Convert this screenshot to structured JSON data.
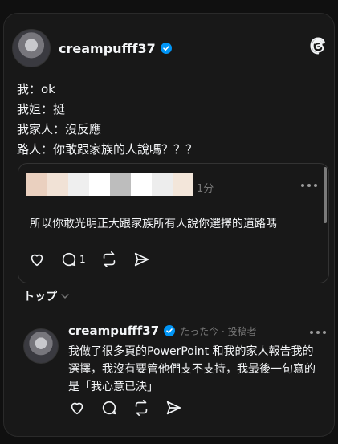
{
  "post": {
    "username": "creampufff37",
    "verified": true,
    "lines": [
      "我：ok",
      "我姐：挺",
      "我家人：沒反應",
      "路人：你敢跟家族的人說嗎？？？"
    ]
  },
  "quote": {
    "time": "1分",
    "text": "所以你敢光明正大跟家族所有人說你選擇的道路嗎",
    "reply_count": "1",
    "blurred_colors": [
      "#ead0bf",
      "#f1e2d6",
      "#efefef",
      "#ffffff",
      "#bdbdbd",
      "#ffffff",
      "#ededed",
      "#f3e6da"
    ]
  },
  "sort": {
    "label": "トップ"
  },
  "reply": {
    "username": "creampufff37",
    "meta": "たった今 · 投稿者",
    "text": "我做了很多頁的PowerPoint 和我的家人報告我的選擇，我沒有要管他們支不支持，我最後一句寫的是「我心意已決」"
  },
  "colors": {
    "background": "#101010",
    "card": "#181818",
    "verified": "#0095f6",
    "muted": "#777777"
  }
}
